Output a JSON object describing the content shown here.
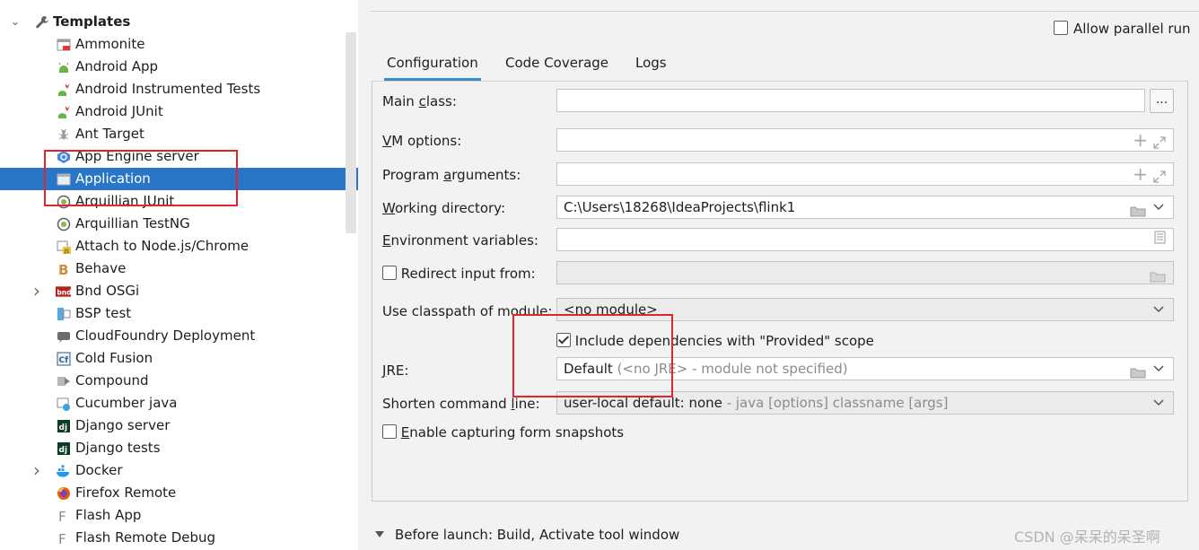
{
  "tree": {
    "root": {
      "label": "Templates",
      "icon": "wrench-icon"
    },
    "items": [
      {
        "label": "Ammonite",
        "icon": "ammonite-icon"
      },
      {
        "label": "Android App",
        "icon": "android-icon"
      },
      {
        "label": "Android Instrumented Tests",
        "icon": "android-test-icon"
      },
      {
        "label": "Android JUnit",
        "icon": "android-test-icon"
      },
      {
        "label": "Ant Target",
        "icon": "ant-icon"
      },
      {
        "label": "App Engine server",
        "icon": "app-engine-icon"
      },
      {
        "label": "Application",
        "icon": "application-icon",
        "selected": true
      },
      {
        "label": "Arquillian JUnit",
        "icon": "arquillian-icon"
      },
      {
        "label": "Arquillian TestNG",
        "icon": "arquillian-icon"
      },
      {
        "label": "Attach to Node.js/Chrome",
        "icon": "nodejs-attach-icon"
      },
      {
        "label": "Behave",
        "icon": "behave-icon"
      },
      {
        "label": "Bnd OSGi",
        "icon": "bnd-icon",
        "expandable": true
      },
      {
        "label": "BSP test",
        "icon": "bsp-icon"
      },
      {
        "label": "CloudFoundry Deployment",
        "icon": "cloudfoundry-icon"
      },
      {
        "label": "Cold Fusion",
        "icon": "coldfusion-icon"
      },
      {
        "label": "Compound",
        "icon": "compound-icon"
      },
      {
        "label": "Cucumber java",
        "icon": "cucumber-icon"
      },
      {
        "label": "Django server",
        "icon": "django-icon"
      },
      {
        "label": "Django tests",
        "icon": "django-icon"
      },
      {
        "label": "Docker",
        "icon": "docker-icon",
        "expandable": true
      },
      {
        "label": "Firefox Remote",
        "icon": "firefox-icon"
      },
      {
        "label": "Flash App",
        "icon": "flash-icon"
      },
      {
        "label": "Flash Remote Debug",
        "icon": "flash-icon"
      }
    ]
  },
  "header": {
    "allow_parallel_run": "Allow parallel run",
    "allow_parallel_checked": false
  },
  "tabs": [
    {
      "label": "Configuration",
      "active": true
    },
    {
      "label": "Code Coverage"
    },
    {
      "label": "Logs"
    }
  ],
  "form": {
    "main_class": {
      "pre": "Main ",
      "u": "c",
      "post": "lass:",
      "value": ""
    },
    "browse_label": "...",
    "vm_options": {
      "pre": "",
      "u": "V",
      "post": "M options:",
      "value": ""
    },
    "program_arguments": {
      "pre": "Program ",
      "u": "a",
      "post": "rguments:",
      "value": ""
    },
    "working_directory": {
      "pre": "",
      "u": "W",
      "post": "orking directory:",
      "value": "C:\\Users\\18268\\IdeaProjects\\flink1"
    },
    "environment_variables": {
      "pre": "",
      "u": "E",
      "post": "nvironment variables:",
      "value": ""
    },
    "redirect_input": {
      "label": "Redirect input from:",
      "checked": false,
      "value": ""
    },
    "classpath_module": {
      "label": "Use classpath of module:",
      "value": "<no module>"
    },
    "include_provided": {
      "label": "Include dependencies with \"Provided\" scope",
      "checked": true
    },
    "jre": {
      "pre": "",
      "u": "J",
      "post": "RE:",
      "value": "Default",
      "hint": " (<no JRE> - module not specified)"
    },
    "shorten_cmd": {
      "pre": "Shorten command ",
      "u": "l",
      "post": "ine:",
      "value": "user-local default: none",
      "hint": " - java [options] classname [args]"
    },
    "form_snapshots": {
      "pre": "",
      "u": "E",
      "post": "nable capturing form snapshots",
      "checked": false
    }
  },
  "before_launch": "Before launch: Build, Activate tool window",
  "watermark": "CSDN @呆呆的呆圣啊",
  "colors": {
    "selection": "#2a76c6",
    "tab_accent": "#3a8bd4",
    "highlight_box": "#e0262c"
  }
}
